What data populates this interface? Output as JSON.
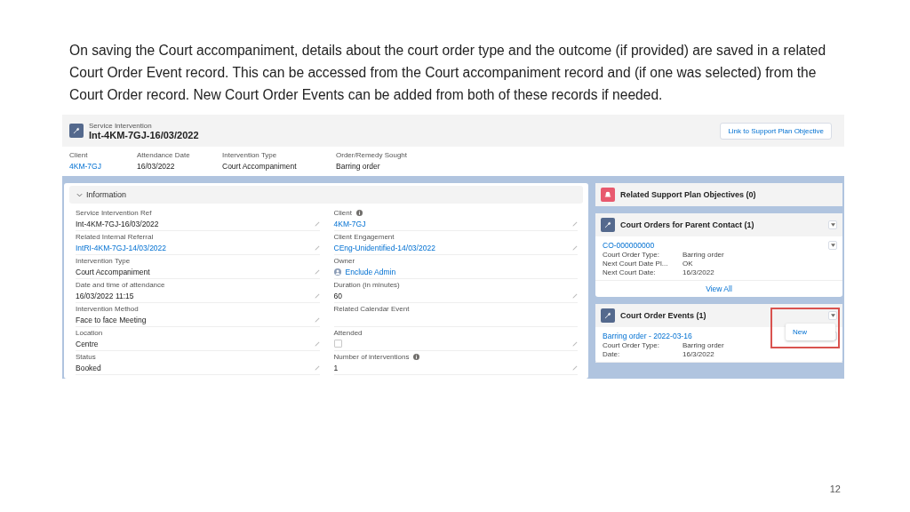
{
  "caption": "On saving the Court accompaniment, details about the court order type and the outcome (if provided) are saved in a related Court Order Event record. This can be accessed from the Court accompaniment record and (if one was selected) from the Court Order record.  New Court Order Events can be added from both of these records if needed.",
  "record": {
    "object_label": "Service Intervention",
    "title": "Int-4KM-7GJ-16/03/2022",
    "button": "Link to Support Plan Objective"
  },
  "highlights": [
    {
      "label": "Client",
      "value": "4KM-7GJ",
      "kind": "link"
    },
    {
      "label": "Attendance Date",
      "value": "16/03/2022",
      "kind": "text"
    },
    {
      "label": "Intervention Type",
      "value": "Court Accompaniment",
      "kind": "text"
    },
    {
      "label": "Order/Remedy Sought",
      "value": "Barring order",
      "kind": "text"
    }
  ],
  "information": {
    "title": "Information",
    "expanded": true,
    "left": [
      {
        "label": "Service Intervention Ref",
        "value": "Int-4KM-7GJ-16/03/2022",
        "kind": "text",
        "info": false,
        "editable": true
      },
      {
        "label": "Related Internal Referral",
        "value": "IntRI-4KM-7GJ-14/03/2022",
        "kind": "link",
        "info": false,
        "editable": true
      },
      {
        "label": "Intervention Type",
        "value": "Court Accompaniment",
        "kind": "text",
        "info": false,
        "editable": true
      },
      {
        "label": "Date and time of attendance",
        "value": "16/03/2022 11:15",
        "kind": "text",
        "info": false,
        "editable": true
      },
      {
        "label": "Intervention Method",
        "value": "Face to face Meeting",
        "kind": "text",
        "info": false,
        "editable": true
      },
      {
        "label": "Location",
        "value": "Centre",
        "kind": "text",
        "info": false,
        "editable": true
      },
      {
        "label": "Status",
        "value": "Booked",
        "kind": "text",
        "info": false,
        "editable": true
      }
    ],
    "right": [
      {
        "label": "Client",
        "value": "4KM-7GJ",
        "kind": "link",
        "info": true,
        "editable": true
      },
      {
        "label": "Client Engagement",
        "value": "CEng-Unidentified-14/03/2022",
        "kind": "link",
        "info": false,
        "editable": true
      },
      {
        "label": "Owner",
        "value": "Enclude Admin",
        "kind": "owner",
        "info": false,
        "editable": false
      },
      {
        "label": "Duration (in minutes)",
        "value": "60",
        "kind": "text",
        "info": false,
        "editable": true
      },
      {
        "label": "Related Calendar Event",
        "kind": "empty",
        "info": false,
        "editable": false
      },
      {
        "label": "Attended",
        "kind": "checkbox",
        "checked": false,
        "info": false,
        "editable": true
      },
      {
        "label": "Number of interventions",
        "value": "1",
        "kind": "text",
        "info": true,
        "editable": true
      }
    ]
  },
  "related": [
    {
      "title": "Related Support Plan Objectives (0)",
      "color": "#e8596e",
      "menu": false
    },
    {
      "title": "Court Orders for Parent Contact (1)",
      "color": "#54698d",
      "menu": true,
      "records": [
        {
          "name": "CO-000000000",
          "fields": [
            {
              "label": "Court Order Type:",
              "value": "Barring order"
            },
            {
              "label": "Next Court Date Pl...",
              "value": "OK"
            },
            {
              "label": "Next Court Date:",
              "value": "16/3/2022"
            }
          ]
        }
      ],
      "footer": "View All"
    },
    {
      "title": "Court Order Events (1)",
      "color": "#54698d",
      "menu": true,
      "menu_open": true,
      "menu_items": [
        "New"
      ],
      "records": [
        {
          "name": "Barring order - 2022-03-16",
          "fields": [
            {
              "label": "Court Order Type:",
              "value": "Barring order"
            },
            {
              "label": "Date:",
              "value": "16/3/2022"
            }
          ]
        }
      ]
    }
  ],
  "slide_number": "12"
}
